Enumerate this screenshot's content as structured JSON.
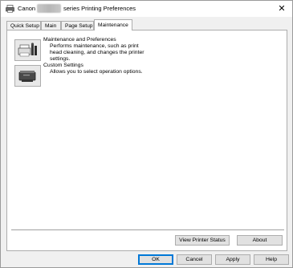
{
  "window": {
    "title_prefix": "Canon",
    "title_suffix": "series Printing Preferences",
    "close_label": "✕"
  },
  "tabs": [
    {
      "label": "Quick Setup"
    },
    {
      "label": "Main"
    },
    {
      "label": "Page Setup"
    },
    {
      "label": "Maintenance"
    }
  ],
  "maintenance": {
    "items": [
      {
        "title": "Maintenance and Preferences",
        "description": "Performs maintenance, such as print head cleaning, and changes the printer settings."
      },
      {
        "title": "Custom Settings",
        "description": "Allows you to select operation options."
      }
    ],
    "view_printer_status": "View Printer Status",
    "about": "About"
  },
  "footer": {
    "ok": "OK",
    "cancel": "Cancel",
    "apply": "Apply",
    "help": "Help"
  }
}
